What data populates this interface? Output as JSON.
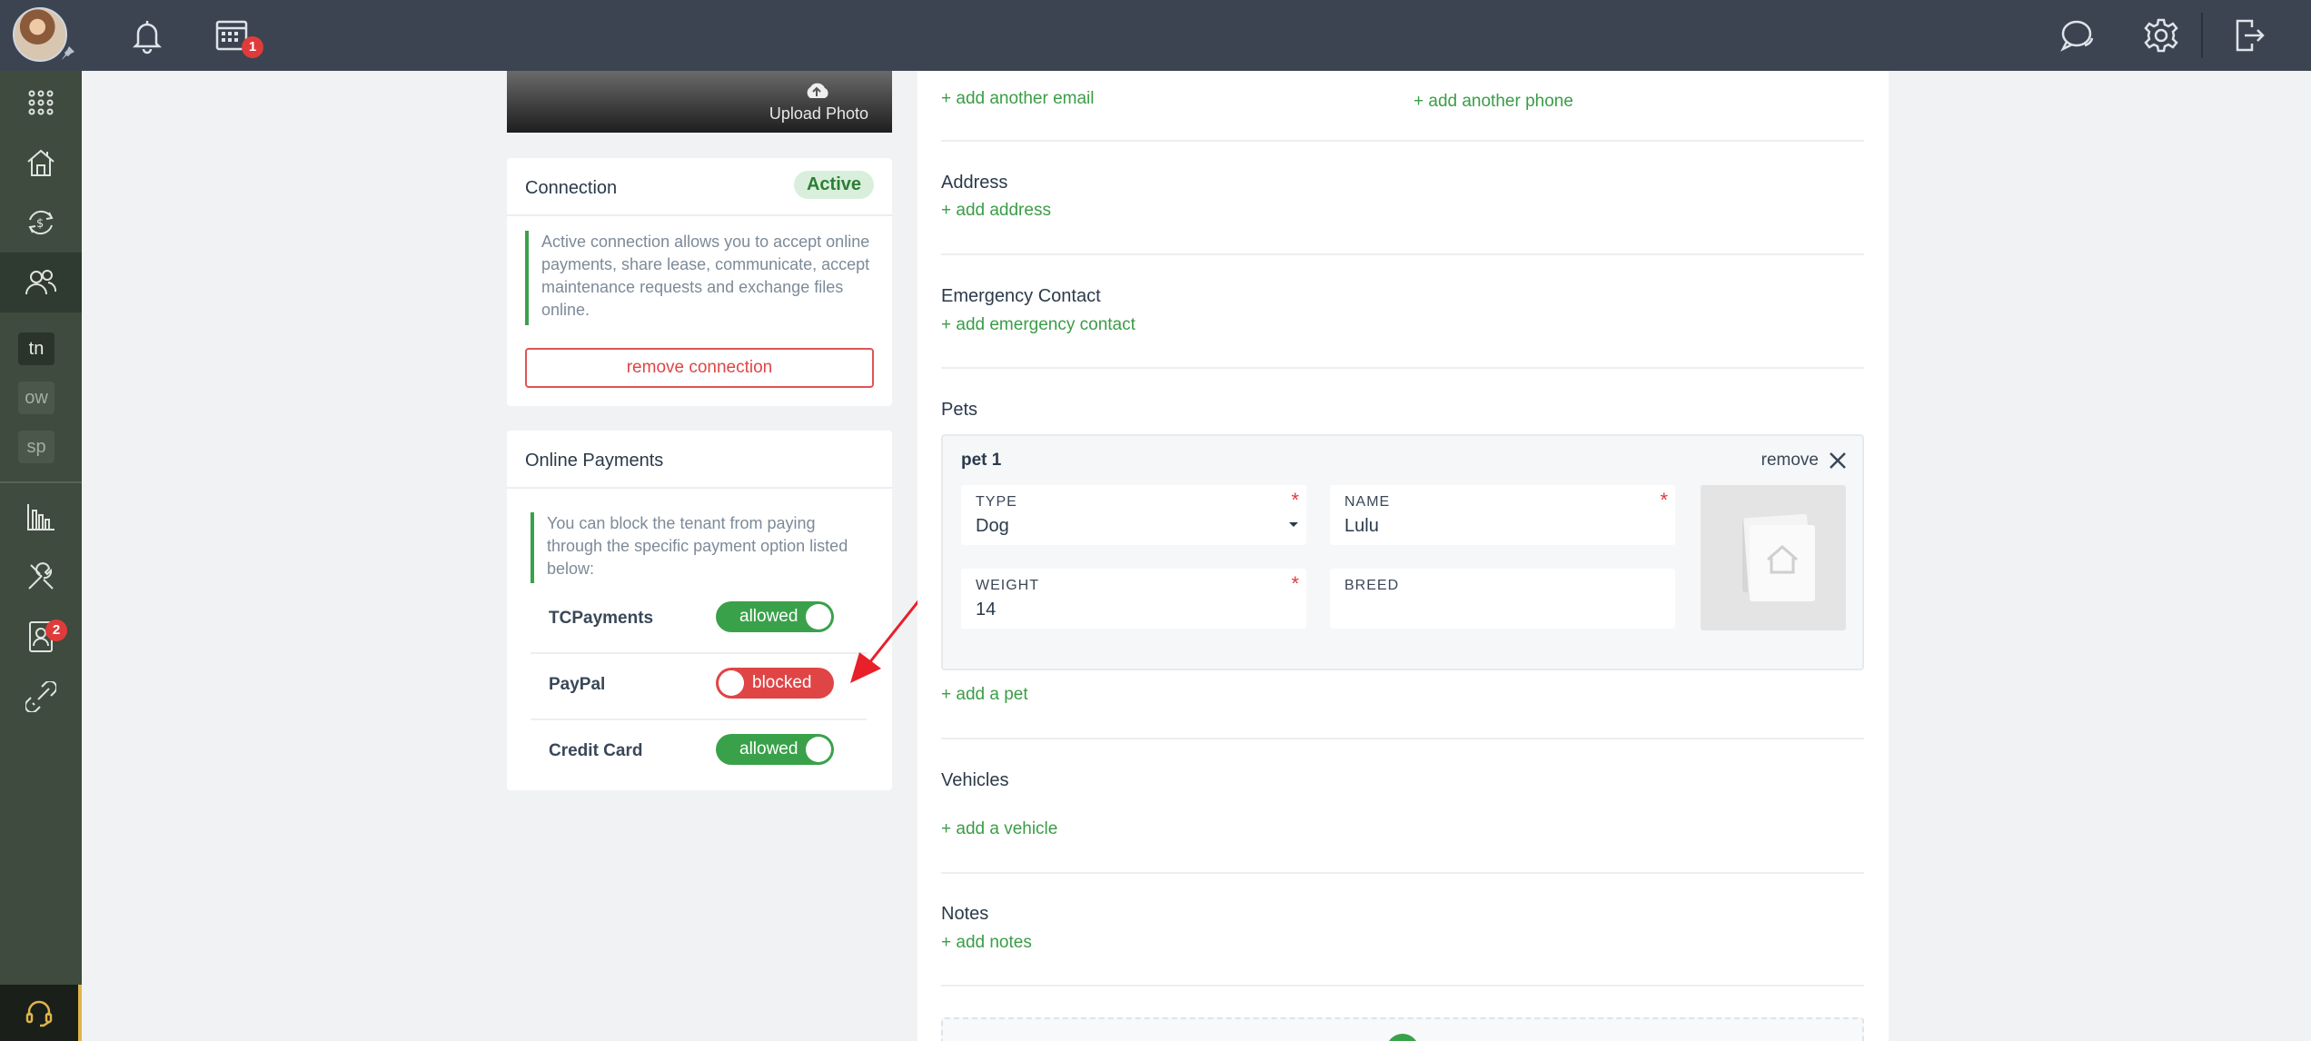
{
  "topbar": {
    "calendar_badge": "1"
  },
  "leftnav": {
    "tags": [
      "tn",
      "ow",
      "sp"
    ],
    "contacts_badge": "2"
  },
  "photo_card": {
    "upload_label": "Upload Photo"
  },
  "connection_card": {
    "title": "Connection",
    "status": "Active",
    "info": "Active connection allows you to accept online payments, share lease, communicate, accept maintenance requests and exchange files online.",
    "remove_label": "remove connection"
  },
  "online_payments_card": {
    "title": "Online Payments",
    "info": "You can block the tenant from paying through the specific payment option listed below:",
    "options": [
      {
        "label": "TCPayments",
        "state": "allowed"
      },
      {
        "label": "PayPal",
        "state": "blocked"
      },
      {
        "label": "Credit Card",
        "state": "allowed"
      }
    ]
  },
  "main": {
    "add_email": "+ add another email",
    "add_phone": "+ add another phone",
    "address": {
      "title": "Address",
      "add": "+ add address"
    },
    "emergency": {
      "title": "Emergency Contact",
      "add": "+ add emergency contact"
    },
    "pets": {
      "title": "Pets",
      "pet": {
        "title": "pet 1",
        "remove": "remove",
        "type_label": "TYPE",
        "type_value": "Dog",
        "name_label": "NAME",
        "name_value": "Lulu",
        "weight_label": "WEIGHT",
        "weight_value": "14",
        "breed_label": "BREED",
        "breed_value": ""
      },
      "add": "+ add a pet"
    },
    "vehicles": {
      "title": "Vehicles",
      "add": "+ add a vehicle"
    },
    "notes": {
      "title": "Notes",
      "add": "+ add notes"
    }
  },
  "colors": {
    "accent_green": "#3aa14b",
    "blocked_red": "#e04545",
    "topbar": "#3b4450",
    "sidebar": "#3e4b3e"
  }
}
